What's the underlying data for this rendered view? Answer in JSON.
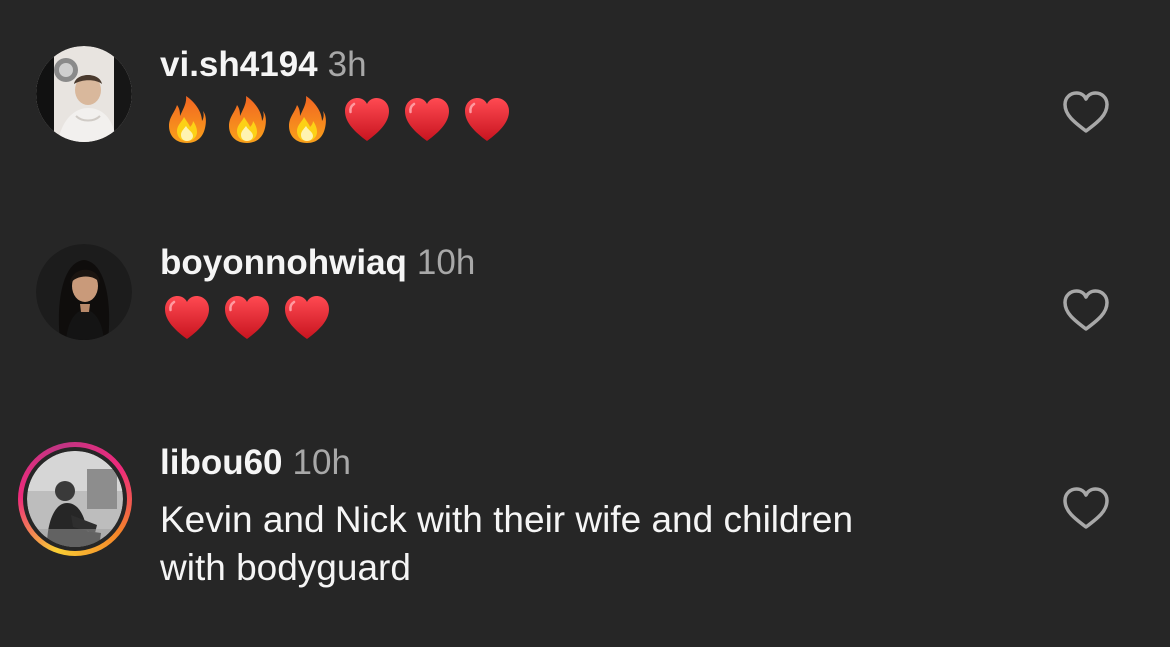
{
  "comments": [
    {
      "username": "vi.sh4194",
      "time": "3h",
      "emojis": [
        "fire",
        "fire",
        "fire",
        "heart",
        "heart",
        "heart"
      ],
      "liked": false,
      "story_ring": false
    },
    {
      "username": "boyonnohwiaq",
      "time": "10h",
      "emojis": [
        "heart",
        "heart",
        "heart"
      ],
      "liked": false,
      "story_ring": false
    },
    {
      "username": "libou60",
      "time": "10h",
      "text_line1": "Kevin and Nick with their wife and children",
      "text_line2": "with bodyguard",
      "liked": false,
      "story_ring": true
    }
  ],
  "colors": {
    "background": "#262626",
    "username": "#f5f5f5",
    "timestamp": "#a8a8a8",
    "like_icon": "#a8a8a8",
    "heart_emoji": "#e0242f",
    "fire_emoji": "#f7941d"
  }
}
